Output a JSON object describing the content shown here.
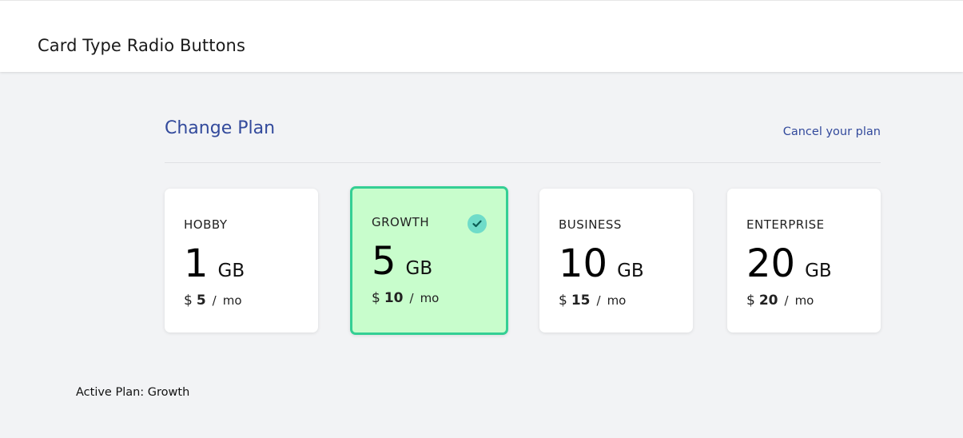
{
  "header": {
    "title": "Card Type Radio Buttons"
  },
  "plan_section": {
    "title": "Change Plan",
    "cancel_label": "Cancel your plan"
  },
  "plans": [
    {
      "name": "HOBBY",
      "size": "1",
      "unit": "GB",
      "currency": "$",
      "price": "5",
      "slash": "/",
      "period": "mo",
      "selected": false
    },
    {
      "name": "GROWTH",
      "size": "5",
      "unit": "GB",
      "currency": "$",
      "price": "10",
      "slash": "/",
      "period": "mo",
      "selected": true
    },
    {
      "name": "BUSINESS",
      "size": "10",
      "unit": "GB",
      "currency": "$",
      "price": "15",
      "slash": "/",
      "period": "mo",
      "selected": false
    },
    {
      "name": "ENTERPRISE",
      "size": "20",
      "unit": "GB",
      "currency": "$",
      "price": "20",
      "slash": "/",
      "period": "mo",
      "selected": false
    }
  ],
  "status": {
    "active_plan": "Active Plan: Growth"
  },
  "icons": {
    "selected_badge": "check-icon"
  },
  "colors": {
    "accent": "#334a9c",
    "selected_bg": "#c8fdcc",
    "selected_border": "#34cf94",
    "badge": "#6fdcc9"
  }
}
